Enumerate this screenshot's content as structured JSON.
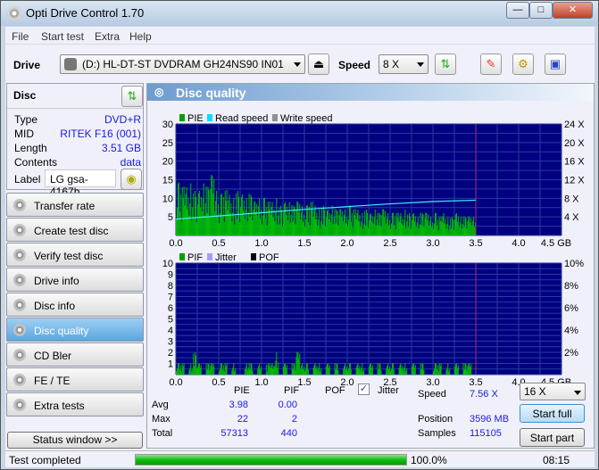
{
  "window": {
    "title": "Opti Drive Control 1.70",
    "minimize": "—",
    "maximize": "□",
    "close": "✕"
  },
  "menu": [
    "File",
    "Start test",
    "Extra",
    "Help"
  ],
  "toolbar": {
    "drive_label": "Drive",
    "drive_value": "(D:)   HL-DT-ST DVDRAM GH24NS90 IN01",
    "speed_label": "Speed",
    "speed_value": "8 X",
    "icons": [
      "eject-icon",
      "refresh-icon",
      "eraser-icon",
      "settings-icon",
      "save-icon"
    ]
  },
  "disc": {
    "title": "Disc",
    "rows": [
      {
        "k": "Type",
        "v": "DVD+R"
      },
      {
        "k": "MID",
        "v": "RITEK F16 (001)"
      },
      {
        "k": "Length",
        "v": "3.51 GB"
      },
      {
        "k": "Contents",
        "v": "data"
      }
    ],
    "label_key": "Label",
    "label_value": "LG gsa-4167b"
  },
  "nav": [
    "Transfer rate",
    "Create test disc",
    "Verify test disc",
    "Drive info",
    "Disc info",
    "Disc quality",
    "CD Bler",
    "FE / TE",
    "Extra tests"
  ],
  "nav_active": "Disc quality",
  "status_window": "Status window >>",
  "panel_title": "Disc quality",
  "chart_data": [
    {
      "type": "bar",
      "legend": [
        "PIE",
        "Read speed",
        "Write speed"
      ],
      "legend_colors": [
        "#00a000",
        "#00e0ff",
        "#909090"
      ],
      "xlim": [
        0,
        4.5
      ],
      "ylim": [
        0,
        30
      ],
      "y2lim": [
        0,
        24
      ],
      "xticks": [
        "0.0",
        "0.5",
        "1.0",
        "1.5",
        "2.0",
        "2.5",
        "3.0",
        "3.5",
        "4.0",
        "4.5 GB"
      ],
      "yticks": [
        "5",
        "10",
        "15",
        "20",
        "25",
        "30"
      ],
      "y2ticks": [
        "4 X",
        "8 X",
        "12 X",
        "16 X",
        "20 X",
        "24 X"
      ],
      "pie_samples_step_gb": 0.05,
      "pie_values": [
        14,
        13,
        13,
        14,
        12,
        12,
        14,
        13,
        16,
        12,
        11,
        12,
        11,
        10,
        12,
        11,
        10,
        11,
        9,
        10,
        10,
        9,
        9,
        10,
        8,
        9,
        9,
        8,
        9,
        8,
        8,
        9,
        8,
        7,
        8,
        7,
        8,
        7,
        7,
        7,
        8,
        7,
        7,
        6,
        7,
        6,
        7,
        6,
        7,
        6,
        6,
        6,
        6,
        7,
        6,
        6,
        5,
        6,
        6,
        5,
        6,
        5,
        6,
        5,
        5,
        6,
        5,
        5,
        5,
        5
      ],
      "read_speed": {
        "x": [
          0,
          0.5,
          1.0,
          1.5,
          2.0,
          2.5,
          3.0,
          3.5
        ],
        "y": [
          3.5,
          4.2,
          4.9,
          5.6,
          6.2,
          6.8,
          7.3,
          7.6
        ]
      },
      "end_marker_gb": 3.5
    },
    {
      "type": "bar",
      "legend": [
        "PIF",
        "Jitter",
        "POF"
      ],
      "legend_colors": [
        "#00a000",
        "#a0a0ff",
        "#000000"
      ],
      "xlim": [
        0,
        4.5
      ],
      "ylim": [
        0,
        10
      ],
      "y2lim": [
        0,
        10
      ],
      "xticks": [
        "0.0",
        "0.5",
        "1.0",
        "1.5",
        "2.0",
        "2.5",
        "3.0",
        "3.5",
        "4.0",
        "4.5 GB"
      ],
      "yticks": [
        "1",
        "2",
        "3",
        "4",
        "5",
        "6",
        "7",
        "8",
        "9",
        "10"
      ],
      "y2ticks": [
        "2%",
        "4%",
        "6%",
        "8%",
        "10%"
      ],
      "pif_values": [
        1,
        1,
        0,
        1,
        2,
        1,
        0,
        1,
        1,
        0,
        1,
        1,
        0,
        1,
        0,
        0,
        1,
        1,
        0,
        1,
        0,
        1,
        1,
        2,
        0,
        1,
        0,
        1,
        2,
        1,
        1,
        0,
        1,
        1,
        0,
        1,
        0,
        1,
        0,
        1,
        1,
        0,
        1,
        1,
        0,
        1,
        0,
        1,
        0,
        1,
        1,
        0,
        1,
        1,
        0,
        1,
        0,
        1,
        0,
        0,
        1,
        1,
        0,
        1,
        0,
        1,
        0,
        1,
        1,
        0
      ]
    }
  ],
  "stats": {
    "headers": [
      "PIE",
      "PIF",
      "POF"
    ],
    "jitter_label": "Jitter",
    "jitter_checked": true,
    "rows": [
      {
        "k": "Avg",
        "pie": "3.98",
        "pif": "0.00"
      },
      {
        "k": "Max",
        "pie": "22",
        "pif": "2"
      },
      {
        "k": "Total",
        "pie": "57313",
        "pif": "440"
      }
    ],
    "speed_label": "Speed",
    "speed_value": "7.56 X",
    "position_label": "Position",
    "position_value": "3596 MB",
    "samples_label": "Samples",
    "samples_value": "115105",
    "speed_select": "16 X",
    "start_full": "Start full",
    "start_part": "Start part"
  },
  "statusbar": {
    "text": "Test completed",
    "progress": 100,
    "progress_text": "100.0%",
    "time": "08:15"
  }
}
